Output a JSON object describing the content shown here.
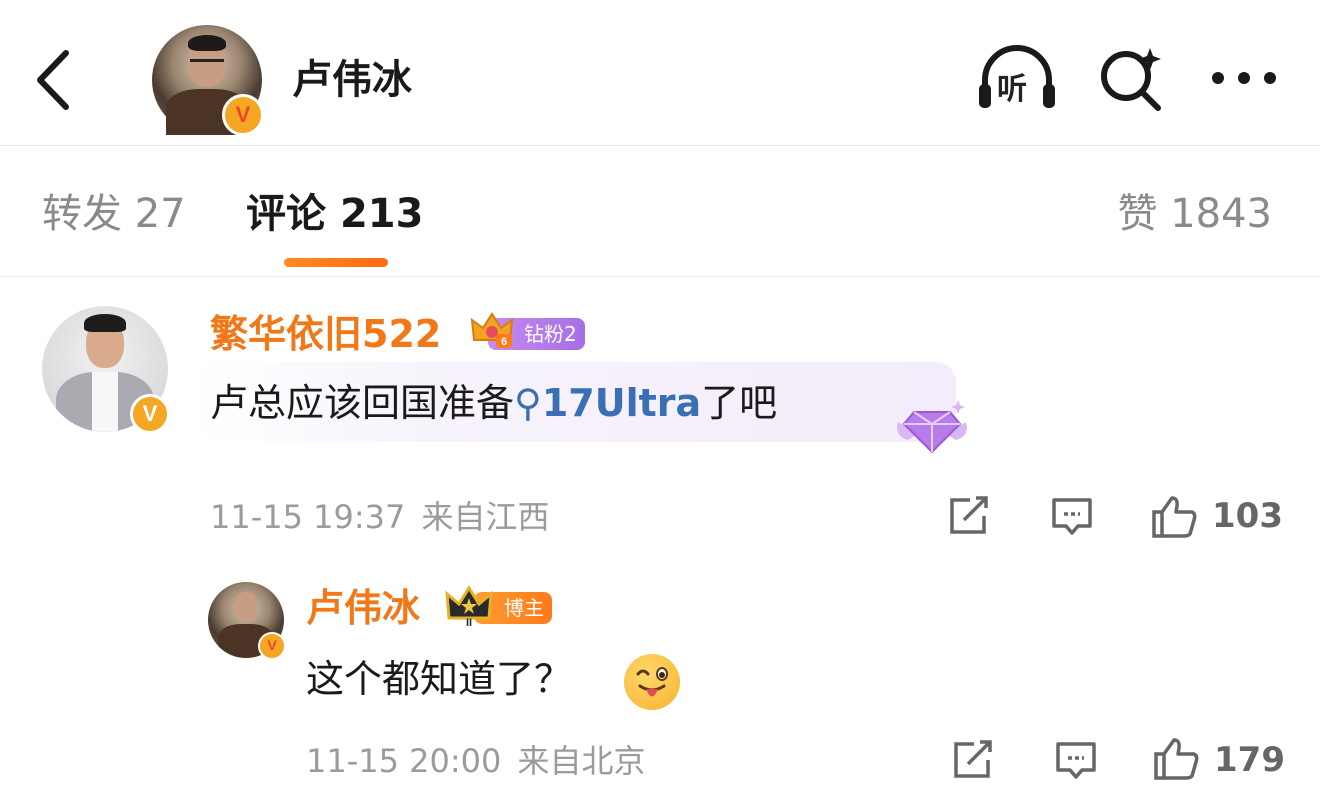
{
  "header": {
    "title": "卢伟冰",
    "listen_label": "听",
    "verified_badge": "V"
  },
  "tabs": [
    {
      "label": "转发",
      "count": "27"
    },
    {
      "label": "评论",
      "count": "213"
    },
    {
      "label": "赞",
      "count": "1843"
    }
  ],
  "comments": [
    {
      "username": "繁华依旧522",
      "level_badge": "6",
      "fan_badge": "钻粉2",
      "text_before": "卢总应该回国准备",
      "topic": "17Ultra",
      "text_after": "了吧",
      "timestamp": "11-15 19:37",
      "location": "来自江西",
      "likes": "103"
    },
    {
      "username": "卢伟冰",
      "level_badge": "II",
      "role_badge": "博主",
      "text": "这个都知道了？",
      "timestamp": "11-15 20:00",
      "location": "来自北京",
      "likes": "179"
    }
  ],
  "colors": {
    "accent_orange": "#f07818",
    "topic_blue": "#3b6fb5",
    "verified_gold": "#f5a623",
    "fan_badge_purple": "#b07ce8"
  },
  "icons": [
    "back-arrow-icon",
    "headphone-icon",
    "search-sparkle-icon",
    "more-dots-icon",
    "repost-icon",
    "comment-icon",
    "thumb-up-icon",
    "crown-icon",
    "diamond-gem-icon",
    "wink-tongue-emoji-icon"
  ]
}
